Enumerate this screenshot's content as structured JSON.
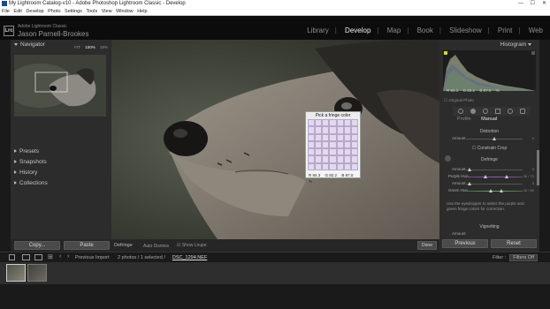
{
  "window": {
    "title": "My Lightroom Catalog-v10 - Adobe Photoshop Lightroom Classic - Develop",
    "controls": [
      "—",
      "☐",
      "✕"
    ]
  },
  "menu": [
    "File",
    "Edit",
    "Develop",
    "Photo",
    "Settings",
    "Tools",
    "View",
    "Window",
    "Help"
  ],
  "identity": {
    "logo": "Lrc",
    "line1": "Adobe Lightroom Classic",
    "line2": "Jason Parnell-Brookes"
  },
  "modules": [
    {
      "label": "Library",
      "active": false
    },
    {
      "label": "Develop",
      "active": true
    },
    {
      "label": "Map",
      "active": false
    },
    {
      "label": "Book",
      "active": false
    },
    {
      "label": "Slideshow",
      "active": false
    },
    {
      "label": "Print",
      "active": false
    },
    {
      "label": "Web",
      "active": false
    }
  ],
  "left_panel": {
    "navigator": {
      "title": "Navigator",
      "zoom": [
        "FIT",
        "100%",
        "16%"
      ]
    },
    "sections": [
      "Presets",
      "Snapshots",
      "History",
      "Collections"
    ],
    "copy_label": "Copy...",
    "paste_label": "Paste"
  },
  "toolbar": {
    "mode": "Defringe",
    "auto_dismiss": "Auto Dismiss",
    "show_loupe": "Show Loupe",
    "done": "Done"
  },
  "fringe_picker": {
    "title": "Pick a fringe color",
    "r": "R 84.3",
    "g": "G 82.2",
    "b": "B 87.0",
    "unit": "%"
  },
  "right_panel": {
    "histogram_title": "Histogram",
    "readout": {
      "r": "R 84.1",
      "g": "G 82.2",
      "b": "B 87.0",
      "unit": "%"
    },
    "original_photo": "Original Photo",
    "tabs": [
      {
        "label": "Profile",
        "active": false
      },
      {
        "label": "Manual",
        "active": true
      }
    ],
    "distortion": "Distortion",
    "amount_label": "Amount",
    "constrain_crop": "Constrain Crop",
    "defringe": "Defringe",
    "purple_hue": "Purple Hue",
    "green_hue": "Green Hue",
    "purple_hue_val": "30 / 70",
    "green_hue_val": "40 / 60",
    "zero": "0",
    "help_text": "Use the eyedropper to select the purple and green fringe colors for correction.",
    "vignetting": "Vignetting",
    "previous_label": "Previous",
    "reset_label": "Reset"
  },
  "filmstrip": {
    "source": "Previous Import",
    "count": "2 photos / 1 selected /",
    "filename": "DSC_1294.NEF",
    "filter_label": "Filter :",
    "filter_value": "Filters Off"
  }
}
